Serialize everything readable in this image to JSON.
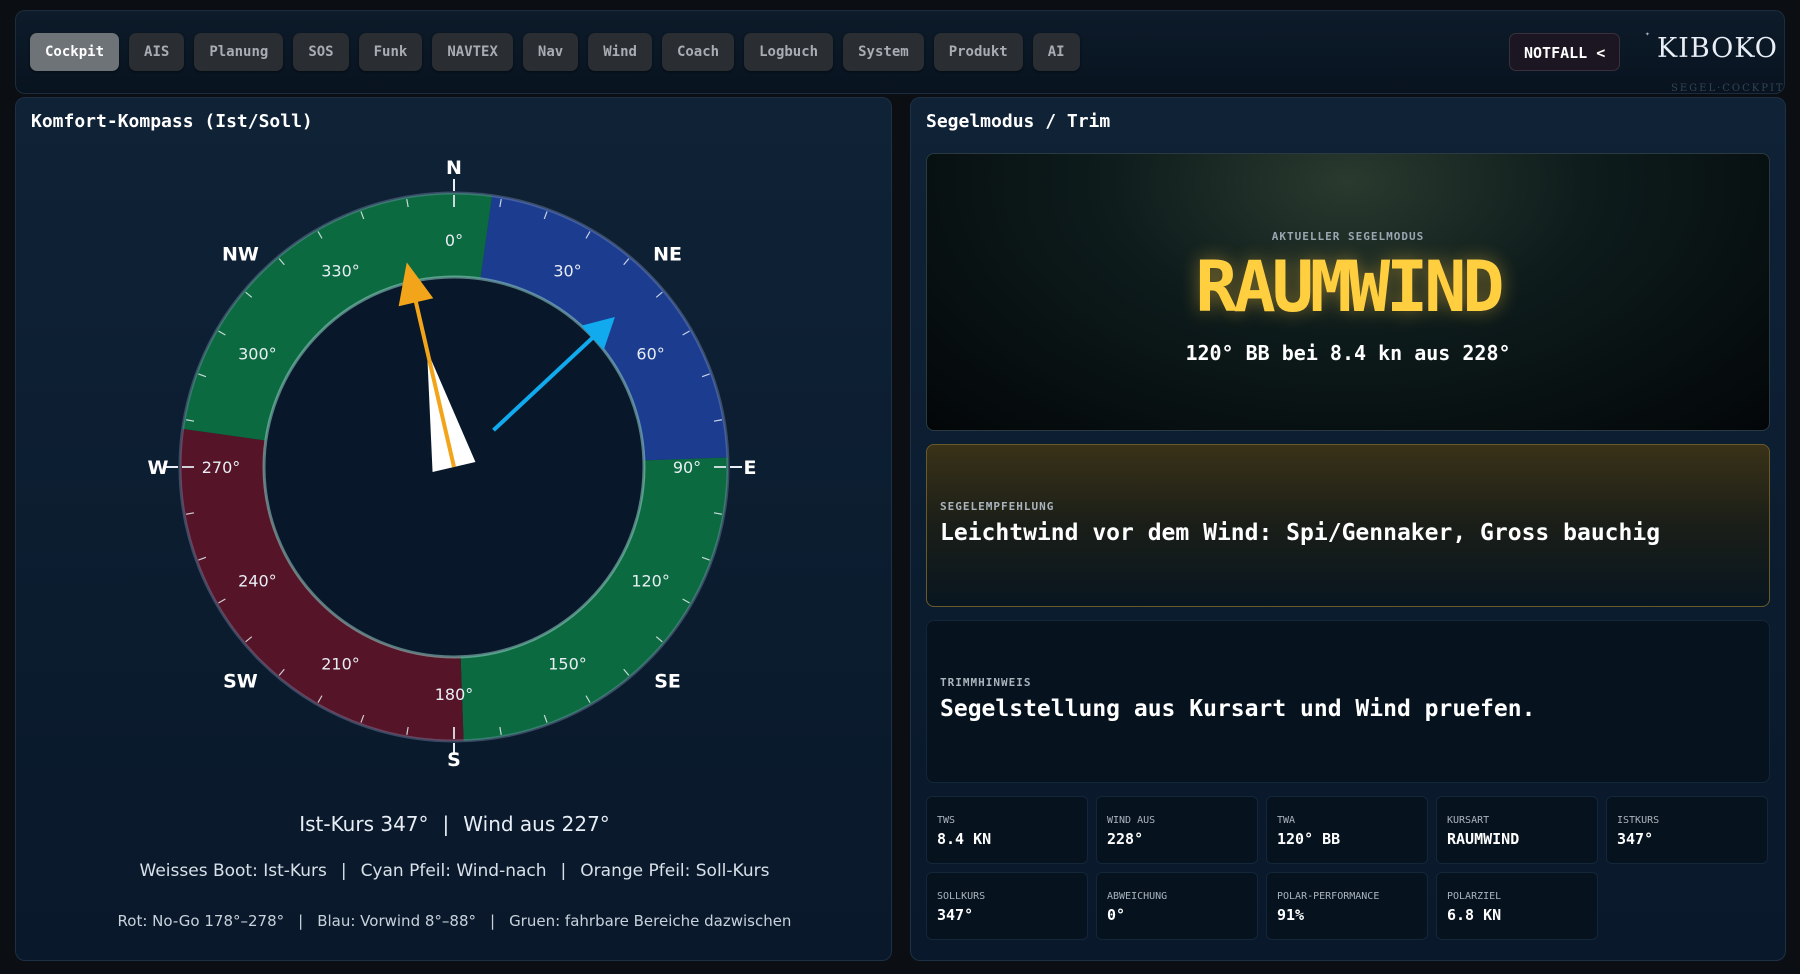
{
  "nav": {
    "tabs": [
      {
        "label": "Cockpit",
        "active": true
      },
      {
        "label": "AIS"
      },
      {
        "label": "Planung"
      },
      {
        "label": "SOS"
      },
      {
        "label": "Funk"
      },
      {
        "label": "NAVTEX"
      },
      {
        "label": "Nav"
      },
      {
        "label": "Wind"
      },
      {
        "label": "Coach"
      },
      {
        "label": "Logbuch"
      },
      {
        "label": "System"
      },
      {
        "label": "Produkt"
      },
      {
        "label": "AI"
      }
    ],
    "emergency_label": "NOTFALL <"
  },
  "logo": {
    "text": "KIBOKO",
    "subtitle": "SEGEL·COCKPIT"
  },
  "compass_panel": {
    "title": "Komfort-Kompass (Ist/Soll)",
    "cardinals": {
      "n": "N",
      "ne": "NE",
      "e": "E",
      "se": "SE",
      "s": "S",
      "sw": "SW",
      "w": "W",
      "nw": "NW"
    },
    "degree_labels": [
      "0°",
      "30°",
      "60°",
      "90°",
      "120°",
      "150°",
      "180°",
      "210°",
      "240°",
      "270°",
      "300°",
      "330°"
    ],
    "ist_kurs_deg": 347,
    "wind_from_deg": 227,
    "soll_kurs_deg": 347,
    "nogo_range_deg": [
      178,
      278
    ],
    "upwind_range_deg": [
      8,
      88
    ],
    "colors": {
      "nogo": "#551427",
      "upwind": "#1c3c8f",
      "ok": "#0c6a40",
      "wind_arrow": "#11aaee",
      "soll_arrow": "#f2a51a",
      "boat": "#ffffff"
    },
    "info_line1_a": "Ist-Kurs 347°",
    "info_line1_b": "Wind aus 227°",
    "separator": "|",
    "legend_boat": "Weisses Boot: Ist-Kurs",
    "legend_wind": "Cyan Pfeil: Wind-nach",
    "legend_soll": "Orange Pfeil: Soll-Kurs",
    "zone_nogo": "Rot: No-Go 178°–278°",
    "zone_upwind": "Blau: Vorwind 8°–88°",
    "zone_ok": "Gruen: fahrbare Bereiche dazwischen"
  },
  "sail_panel": {
    "title": "Segelmodus / Trim",
    "mode_label": "AKTUELLER SEGELMODUS",
    "mode_value": "RAUMWIND",
    "mode_sub": "120° BB bei 8.4 kn aus 228°",
    "recommendation_label": "SEGELEMPFEHLUNG",
    "recommendation_value": "Leichtwind vor dem Wind: Spi/Gennaker, Gross bauchig",
    "trim_label": "TRIMMHINWEIS",
    "trim_value": "Segelstellung aus Kursart und Wind pruefen.",
    "stats": [
      {
        "label": "TWS",
        "value": "8.4 KN"
      },
      {
        "label": "WIND AUS",
        "value": "228°"
      },
      {
        "label": "TWA",
        "value": "120° BB"
      },
      {
        "label": "KURSART",
        "value": "RAUMWIND"
      },
      {
        "label": "ISTKURS",
        "value": "347°"
      },
      {
        "label": "SOLLKURS",
        "value": "347°"
      },
      {
        "label": "ABWEICHUNG",
        "value": "0°"
      },
      {
        "label": "POLAR-PERFORMANCE",
        "value": "91%"
      },
      {
        "label": "POLARZIEL",
        "value": "6.8 KN"
      }
    ]
  }
}
